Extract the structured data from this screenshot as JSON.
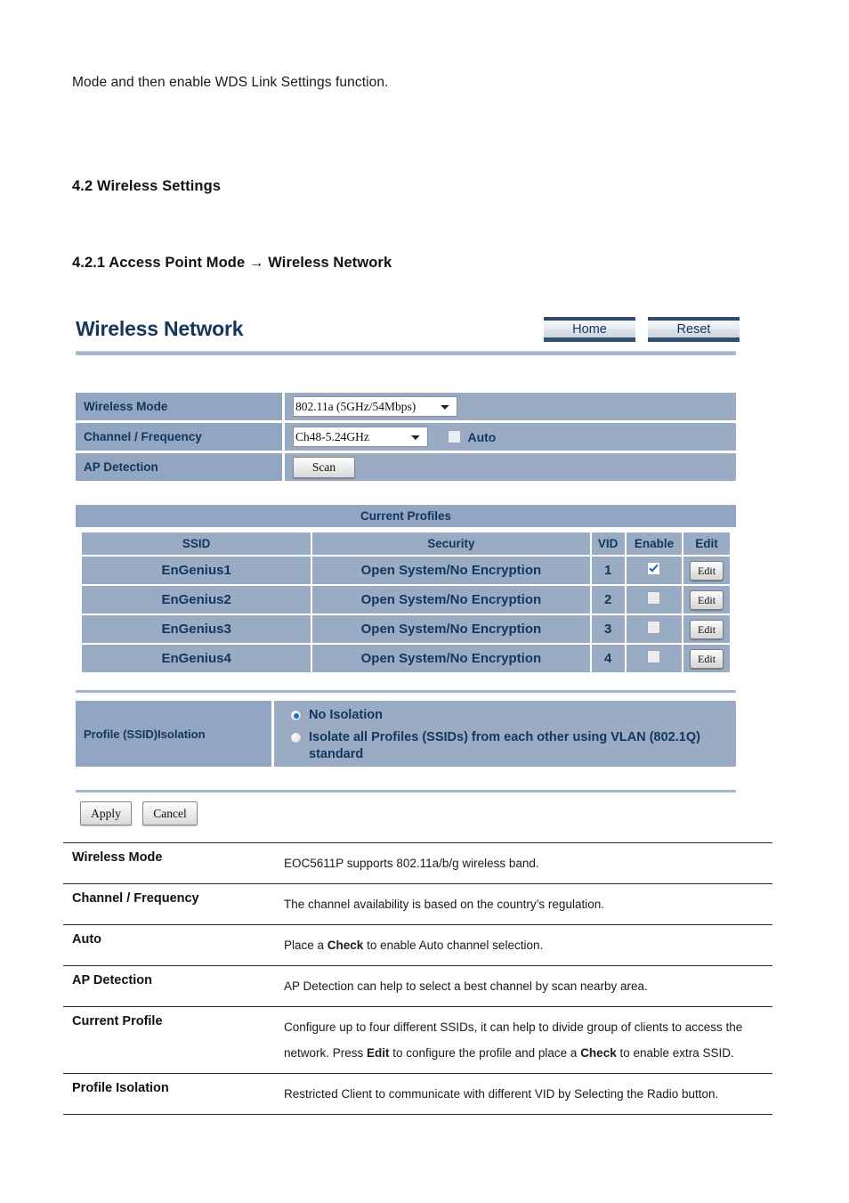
{
  "document": {
    "intro_paragraph": "Mode and then enable WDS Link Settings function.",
    "section_heading": "4.2 Wireless Settings",
    "subsection_heading": "4.2.1 Access Point Mode → Wireless Network"
  },
  "ui": {
    "title": "Wireless Network",
    "header_buttons": [
      {
        "label": "Home"
      },
      {
        "label": "Reset"
      }
    ],
    "settings": [
      {
        "label": "Wireless Mode",
        "control": "select",
        "value": "802.11a (5GHz/54Mbps)",
        "options": [
          "802.11a (5GHz/54Mbps)"
        ]
      },
      {
        "label": "Channel / Frequency",
        "control": "select",
        "value": "Ch48-5.24GHz",
        "options": [
          "Ch48-5.24GHz"
        ],
        "extra_checkbox_label": "Auto",
        "extra_checkbox_checked": false
      },
      {
        "label": "AP Detection",
        "control": "button",
        "button_label": "Scan"
      }
    ],
    "profiles": {
      "section_title": "Current Profiles",
      "columns": [
        "SSID",
        "Security",
        "VID",
        "Enable",
        "Edit"
      ],
      "edit_label": "Edit",
      "rows": [
        {
          "ssid": "EnGenius1",
          "security": "Open System/No Encryption",
          "vid": "1",
          "enabled": true
        },
        {
          "ssid": "EnGenius2",
          "security": "Open System/No Encryption",
          "vid": "2",
          "enabled": false
        },
        {
          "ssid": "EnGenius3",
          "security": "Open System/No Encryption",
          "vid": "3",
          "enabled": false
        },
        {
          "ssid": "EnGenius4",
          "security": "Open System/No Encryption",
          "vid": "4",
          "enabled": false
        }
      ]
    },
    "isolation": {
      "label": "Profile (SSID)Isolation",
      "options": [
        {
          "label": "No Isolation",
          "selected": true
        },
        {
          "label": "Isolate all Profiles (SSIDs) from each other using VLAN (802.1Q) standard",
          "selected": false
        }
      ]
    },
    "actions": {
      "apply_label": "Apply",
      "cancel_label": "Cancel"
    },
    "colors": {
      "label_cell": "#93a6c1",
      "value_cell": "#9aabc4",
      "text_navy": "#14365c",
      "rule": "#a4b4ca"
    }
  },
  "descriptions": {
    "rows": [
      {
        "term": "Wireless Mode",
        "definition": "EOC5611P supports 802.11a/b/g wireless band."
      },
      {
        "term": "Channel / Frequency",
        "definition": "The channel availability is based on the country’s regulation."
      },
      {
        "term": "Auto",
        "definition": "Place a Check to enable Auto channel selection."
      },
      {
        "term": "AP Detection",
        "definition": "AP Detection can help to select a best channel by scan nearby area."
      },
      {
        "term": "Current Profile",
        "definition": "Configure up to four different SSIDs, it can help to divide group of clients to access the network. Press Edit to configure the profile and place a Check to enable extra SSID."
      },
      {
        "term": "Profile Isolation",
        "definition": "Restricted Client to communicate with different VID by Selecting the Radio button."
      }
    ]
  }
}
